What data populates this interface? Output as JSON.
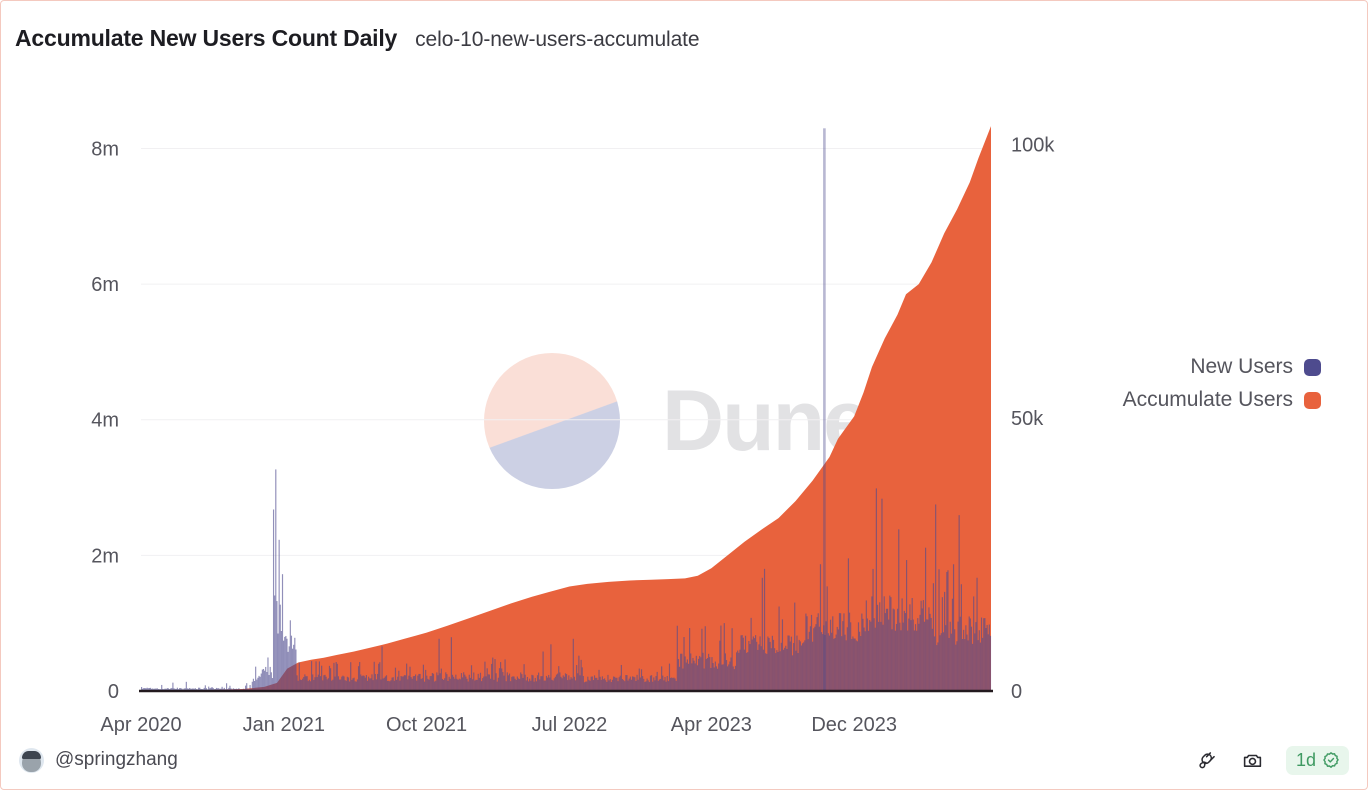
{
  "header": {
    "title": "Accumulate New Users Count Daily",
    "subtitle": "celo-10-new-users-accumulate"
  },
  "legend": {
    "items": [
      {
        "label": "New Users",
        "color": "#4e4b8e"
      },
      {
        "label": "Accumulate Users",
        "color": "#e8623d"
      }
    ]
  },
  "watermark": {
    "text": "Dune"
  },
  "footer": {
    "author": "@springzhang",
    "tools": [
      {
        "name": "plug-icon",
        "label": ""
      },
      {
        "name": "camera-icon",
        "label": ""
      }
    ],
    "freshness": "1d"
  },
  "chart_data": {
    "type": "area",
    "title": "Accumulate New Users Count Daily",
    "subtitle": "celo-10-new-users-accumulate",
    "xlabel": "",
    "ylabel": "",
    "grid": true,
    "legend_position": "right",
    "x_ticks": [
      "Apr 2020",
      "Jan 2021",
      "Oct 2021",
      "Jul 2022",
      "Apr 2023",
      "Dec 2023"
    ],
    "x_tick_positions": [
      0.0,
      0.168,
      0.336,
      0.504,
      0.671,
      0.839
    ],
    "left_axis": {
      "name": "Accumulate Users",
      "ticks": [
        "0",
        "2m",
        "4m",
        "6m",
        "8m"
      ],
      "tick_values": [
        0,
        2000000,
        4000000,
        6000000,
        8000000
      ],
      "ylim": [
        0,
        8700000
      ]
    },
    "right_axis": {
      "name": "New Users",
      "ticks": [
        "0",
        "50k",
        "100k"
      ],
      "tick_values": [
        0,
        50000,
        100000
      ],
      "ylim": [
        0,
        108000
      ]
    },
    "series": [
      {
        "name": "Accumulate Users",
        "type": "area",
        "axis": "left",
        "color": "#e8623d",
        "x": [
          0.0,
          0.04,
          0.08,
          0.12,
          0.145,
          0.16,
          0.172,
          0.185,
          0.2,
          0.215,
          0.23,
          0.25,
          0.27,
          0.29,
          0.31,
          0.336,
          0.36,
          0.385,
          0.41,
          0.435,
          0.46,
          0.48,
          0.504,
          0.525,
          0.55,
          0.575,
          0.6,
          0.62,
          0.64,
          0.655,
          0.671,
          0.69,
          0.71,
          0.73,
          0.75,
          0.77,
          0.79,
          0.81,
          0.82,
          0.839,
          0.85,
          0.86,
          0.875,
          0.89,
          0.9,
          0.915,
          0.93,
          0.945,
          0.96,
          0.975,
          0.985,
          1.0
        ],
        "values": [
          3000,
          8000,
          15000,
          30000,
          60000,
          120000,
          330000,
          420000,
          460000,
          490000,
          530000,
          580000,
          640000,
          700000,
          770000,
          860000,
          960000,
          1070000,
          1180000,
          1290000,
          1390000,
          1460000,
          1540000,
          1580000,
          1610000,
          1630000,
          1640000,
          1650000,
          1660000,
          1700000,
          1810000,
          2000000,
          2200000,
          2380000,
          2550000,
          2800000,
          3100000,
          3450000,
          3720000,
          4050000,
          4400000,
          4780000,
          5200000,
          5550000,
          5850000,
          6000000,
          6320000,
          6750000,
          7100000,
          7500000,
          7850000,
          8330000
        ]
      },
      {
        "name": "New Users",
        "type": "bar",
        "axis": "right",
        "color": "#4e4b8e",
        "opacity": 0.62,
        "max_spike": {
          "x": 0.804,
          "value": 103000,
          "note": "single-day outlier spike"
        },
        "segments": [
          {
            "x_from": 0.0,
            "x_to": 0.13,
            "baseline": 300,
            "noise": 900
          },
          {
            "x_from": 0.13,
            "x_to": 0.155,
            "baseline": 1500,
            "noise": 9000
          },
          {
            "x_from": 0.155,
            "x_to": 0.168,
            "baseline": 9000,
            "noise": 26000
          },
          {
            "x_from": 0.168,
            "x_to": 0.182,
            "baseline": 7000,
            "noise": 12000
          },
          {
            "x_from": 0.182,
            "x_to": 0.34,
            "baseline": 1700,
            "noise": 4200
          },
          {
            "x_from": 0.34,
            "x_to": 0.52,
            "baseline": 1700,
            "noise": 5200
          },
          {
            "x_from": 0.52,
            "x_to": 0.63,
            "baseline": 1600,
            "noise": 4000
          },
          {
            "x_from": 0.63,
            "x_to": 0.7,
            "baseline": 4000,
            "noise": 9000
          },
          {
            "x_from": 0.7,
            "x_to": 0.78,
            "baseline": 6500,
            "noise": 11000
          },
          {
            "x_from": 0.78,
            "x_to": 0.86,
            "baseline": 9000,
            "noise": 16000
          },
          {
            "x_from": 0.86,
            "x_to": 0.93,
            "baseline": 11000,
            "noise": 20000
          },
          {
            "x_from": 0.93,
            "x_to": 1.0,
            "baseline": 8000,
            "noise": 17000
          }
        ]
      }
    ]
  }
}
